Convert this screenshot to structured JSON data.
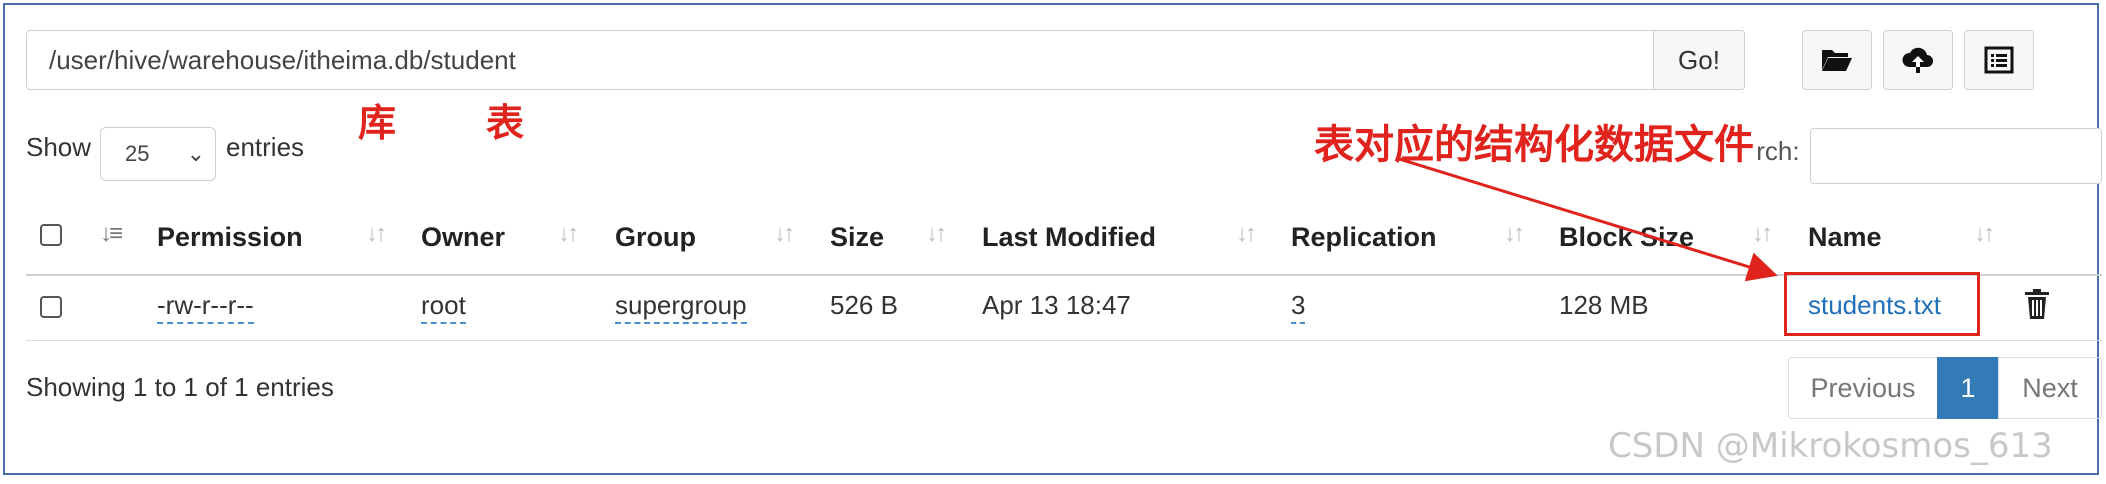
{
  "path_bar": {
    "value": "/user/hive/warehouse/itheima.db/student",
    "go_label": "Go!"
  },
  "toolbar": {
    "icons": [
      "folder-open-icon",
      "cloud-upload-icon",
      "list-view-icon"
    ]
  },
  "annotations": {
    "db_label": "库",
    "table_label": "表",
    "callout": "表对应的结构化数据文件",
    "color": "#e0231c"
  },
  "length_menu": {
    "show_label": "Show",
    "selected": "25",
    "entries_label": "entries"
  },
  "search": {
    "label": "Search:",
    "value": ""
  },
  "table": {
    "columns": [
      "Permission",
      "Owner",
      "Group",
      "Size",
      "Last Modified",
      "Replication",
      "Block Size",
      "Name"
    ],
    "rows": [
      {
        "permission": "-rw-r--r--",
        "owner": "root",
        "group": "supergroup",
        "size": "526 B",
        "last_modified": "Apr 13 18:47",
        "replication": "3",
        "block_size": "128 MB",
        "name": "students.txt"
      }
    ]
  },
  "info_text": "Showing 1 to 1 of 1 entries",
  "pagination": {
    "previous": "Previous",
    "current": "1",
    "next": "Next",
    "active_color": "#337ab7"
  },
  "watermark": "CSDN @Mikrokosmos_613"
}
